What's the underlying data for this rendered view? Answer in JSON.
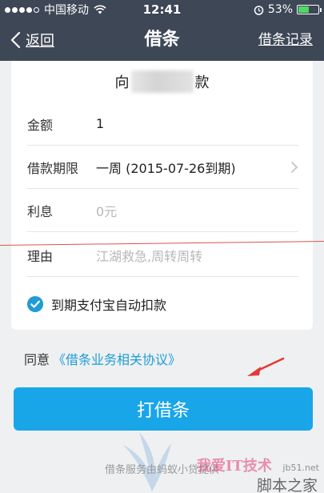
{
  "status_bar": {
    "carrier": "中国移动",
    "time": "12:41",
    "battery": "53%",
    "battery_level": 0.53,
    "signal_bars_filled": 4,
    "signal_bars_total": 5
  },
  "nav": {
    "back_label": "返回",
    "title": "借条",
    "records_label": "借条记录"
  },
  "recipient": {
    "prefix": "向",
    "suffix": "款"
  },
  "form": {
    "amount_label": "金额",
    "amount_value": "1",
    "term_label": "借款期限",
    "term_value": "一周 (2015-07-26到期)",
    "interest_label": "利息",
    "interest_placeholder": "0元",
    "reason_label": "理由",
    "reason_placeholder": "江湖救急,周转周转"
  },
  "auto_pay": {
    "label": "到期支付宝自动扣款",
    "checked": true
  },
  "agreement": {
    "prefix": "同意",
    "link": "《借条业务相关协议》"
  },
  "primary_button": {
    "label": "打借条"
  },
  "footer": {
    "text": "借条服务由蚂蚁小贷提供"
  },
  "watermarks": {
    "site_cn": "我爱IT技术",
    "site_url": "jb51.net",
    "site_name": "脚本之家"
  },
  "colors": {
    "nav_bg": "#3e4756",
    "accent": "#19a6e8",
    "link": "#1f9cd6",
    "annotation_red": "#e03b35"
  }
}
